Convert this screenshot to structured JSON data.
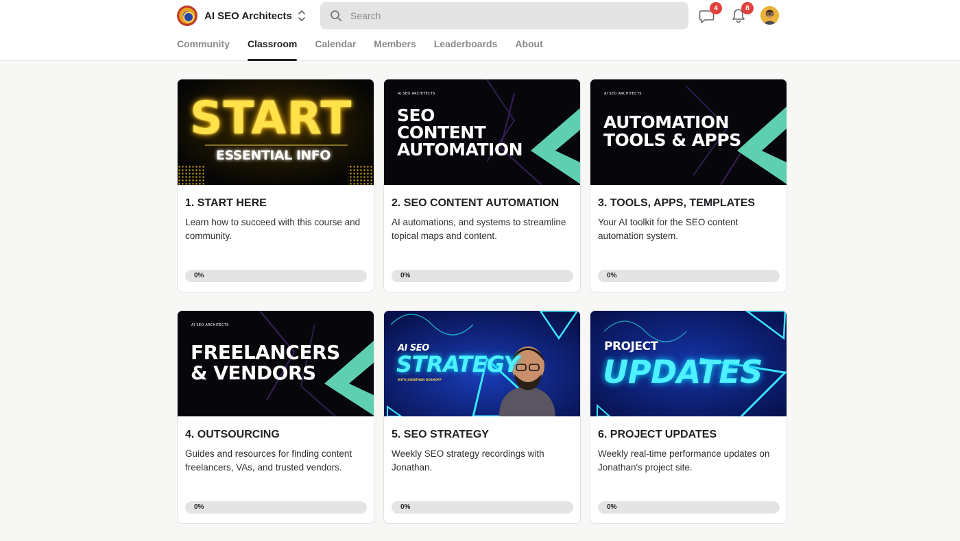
{
  "brand": {
    "name": "AI SEO Architects"
  },
  "search": {
    "placeholder": "Search"
  },
  "notifications": {
    "chat_count": "4",
    "bell_count": "8"
  },
  "tabs": [
    {
      "label": "Community"
    },
    {
      "label": "Classroom"
    },
    {
      "label": "Calendar"
    },
    {
      "label": "Members"
    },
    {
      "label": "Leaderboards"
    },
    {
      "label": "About"
    }
  ],
  "active_tab": "Classroom",
  "colors": {
    "accent_teal": "#5fcfb2",
    "neon_yellow": "#ffe14a",
    "neon_cyan": "#39e6ff",
    "badge_red": "#e0413b"
  },
  "courses": [
    {
      "title": "1. START HERE",
      "description": "Learn how to succeed with this course and community.",
      "progress_label": "0%",
      "progress": 0,
      "thumb": {
        "line1": "START",
        "line2": "ESSENTIAL INFO"
      }
    },
    {
      "title": "2. SEO CONTENT AUTOMATION",
      "description": "AI automations, and systems to streamline topical maps and content.",
      "progress_label": "0%",
      "progress": 0,
      "thumb": {
        "brand": "AI SEO ARCHITECTS",
        "line1": "SEO",
        "line2": "CONTENT",
        "line3": "AUTOMATION"
      }
    },
    {
      "title": "3. TOOLS, APPS, TEMPLATES",
      "description": "Your AI toolkit for the SEO content automation system.",
      "progress_label": "0%",
      "progress": 0,
      "thumb": {
        "brand": "AI SEO ARCHITECTS",
        "line1": "AUTOMATION",
        "line2": "TOOLS & APPS"
      }
    },
    {
      "title": "4. OUTSOURCING",
      "description": "Guides and resources for finding content freelancers, VAs, and trusted vendors.",
      "progress_label": "0%",
      "progress": 0,
      "thumb": {
        "brand": "AI SEO ARCHITECTS",
        "line1": "FREELANCERS",
        "line2": "& VENDORS"
      }
    },
    {
      "title": "5. SEO STRATEGY",
      "description": "Weekly SEO strategy recordings with Jonathan.",
      "progress_label": "0%",
      "progress": 0,
      "thumb": {
        "line1": "AI SEO",
        "line2": "STRATEGY",
        "line3": "WITH JONATHAN BOSHOFF"
      }
    },
    {
      "title": "6. PROJECT UPDATES",
      "description": "Weekly real-time performance updates on Jonathan's project site.",
      "progress_label": "0%",
      "progress": 0,
      "thumb": {
        "line1": "PROJECT",
        "line2": "UPDATES"
      }
    }
  ]
}
